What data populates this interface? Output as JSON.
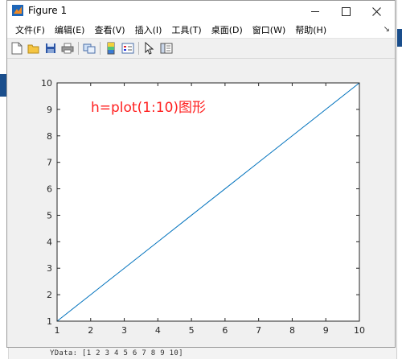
{
  "window": {
    "title": "Figure 1"
  },
  "menu": [
    {
      "label": "文件(F)"
    },
    {
      "label": "编辑(E)"
    },
    {
      "label": "查看(V)"
    },
    {
      "label": "插入(I)"
    },
    {
      "label": "工具(T)"
    },
    {
      "label": "桌面(D)"
    },
    {
      "label": "窗口(W)"
    },
    {
      "label": "帮助(H)"
    }
  ],
  "toolbar_icons": [
    "new-figure-icon",
    "open-file-icon",
    "save-icon",
    "print-icon",
    "link-plot-icon",
    "colorbar-icon",
    "legend-icon",
    "pointer-icon",
    "property-editor-icon"
  ],
  "annotation": "h=plot(1:10)图形",
  "annotation_color": "#ff2020",
  "line_color": "#0072bd",
  "background_fragments": {
    "ydata": "YData: [1 2 3 4 5 6 7 8 9 10]"
  },
  "chart_data": {
    "type": "line",
    "title": "",
    "xlabel": "",
    "ylabel": "",
    "xlim": [
      1,
      10
    ],
    "ylim": [
      1,
      10
    ],
    "xticks": [
      1,
      2,
      3,
      4,
      5,
      6,
      7,
      8,
      9,
      10
    ],
    "yticks": [
      1,
      2,
      3,
      4,
      5,
      6,
      7,
      8,
      9,
      10
    ],
    "grid": false,
    "series": [
      {
        "x": [
          1,
          2,
          3,
          4,
          5,
          6,
          7,
          8,
          9,
          10
        ],
        "y": [
          1,
          2,
          3,
          4,
          5,
          6,
          7,
          8,
          9,
          10
        ]
      }
    ]
  }
}
